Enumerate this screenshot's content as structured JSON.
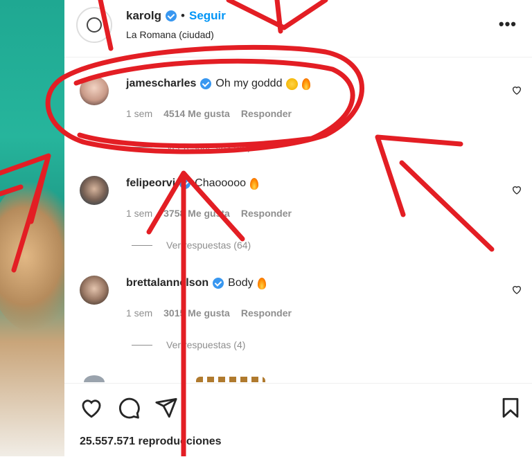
{
  "post": {
    "username": "karolg",
    "follow_label": "Seguir",
    "separator": "•",
    "location": "La Romana (ciudad)",
    "more_label": "•••"
  },
  "comments": [
    {
      "username": "jamescharles",
      "text": "Oh my goddd",
      "time": "1 sem",
      "likes": "4514 Me gusta",
      "reply_label": "Responder",
      "replies_label": "Ver respuestas (40)"
    },
    {
      "username": "felipeorvi",
      "text": "Chaooooo",
      "time": "1 sem",
      "likes": "3758 Me gusta",
      "reply_label": "Responder",
      "replies_label": "Ver respuestas (64)"
    },
    {
      "username": "brettalannelson",
      "text": "Body",
      "time": "1 sem",
      "likes": "3015 Me gusta",
      "reply_label": "Responder",
      "replies_label": "Ver respuestas (4)"
    }
  ],
  "footer": {
    "views": "25.557.571 reproducciones"
  },
  "colors": {
    "link": "#0095f6",
    "verified": "#3897f0",
    "annotation": "#e31e24"
  },
  "icons": [
    "heart-icon",
    "comment-icon",
    "share-icon",
    "bookmark-icon",
    "verified-icon",
    "more-icon"
  ]
}
